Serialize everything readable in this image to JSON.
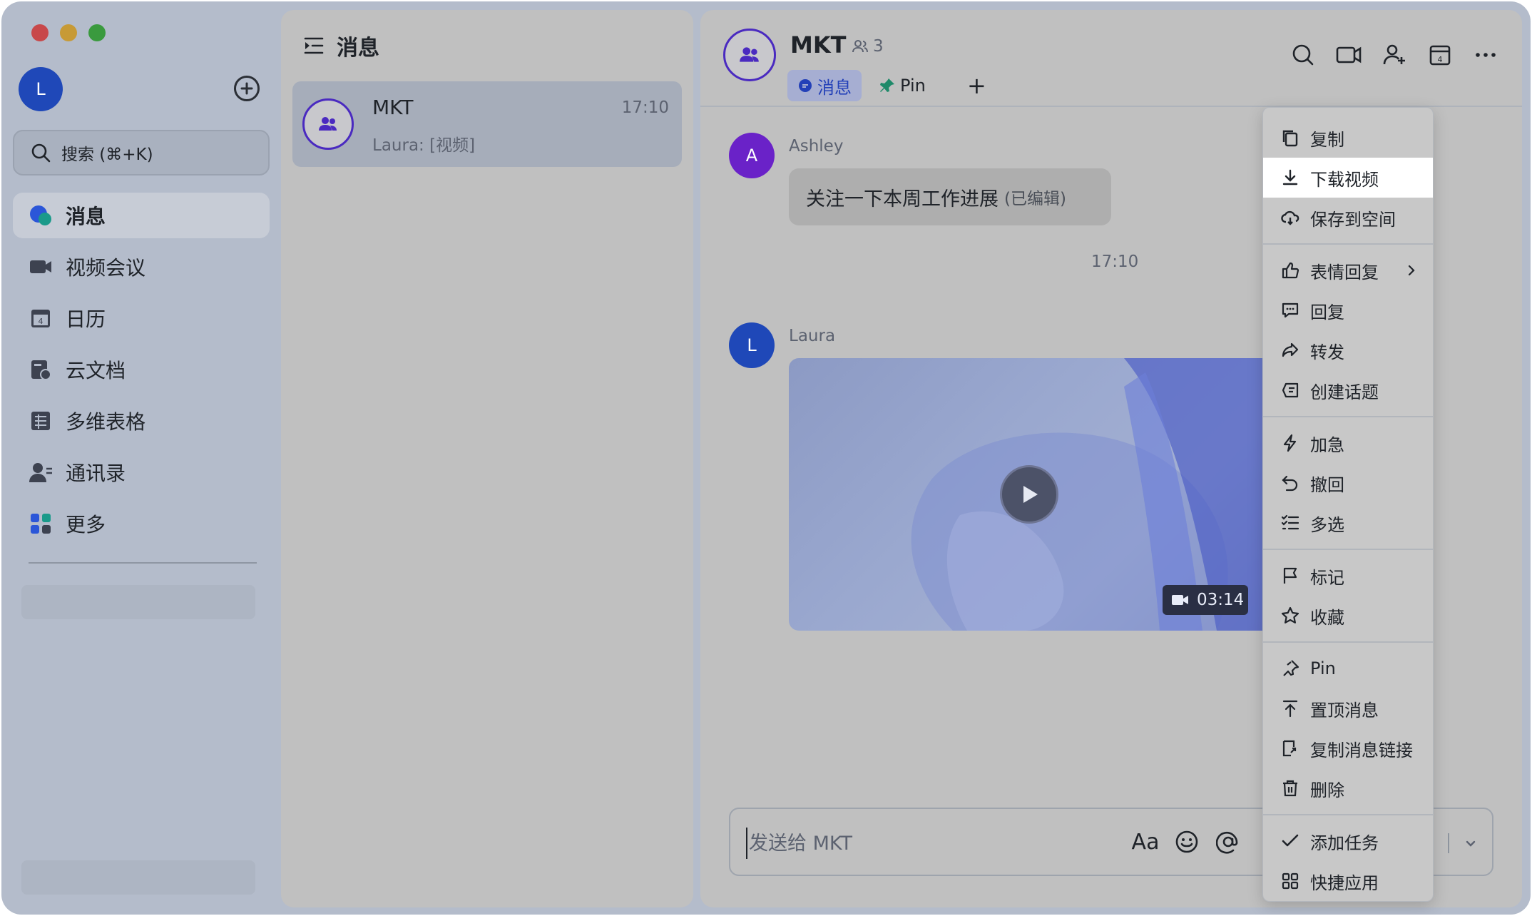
{
  "user": {
    "avatar_initial": "L"
  },
  "search": {
    "placeholder": "搜索 (⌘+K)"
  },
  "sidebar": {
    "items": [
      {
        "label": "消息",
        "icon": "message-bubble-icon",
        "active": true
      },
      {
        "label": "视频会议",
        "icon": "video-camera-icon"
      },
      {
        "label": "日历",
        "icon": "calendar-icon"
      },
      {
        "label": "云文档",
        "icon": "cloud-doc-icon"
      },
      {
        "label": "多维表格",
        "icon": "base-table-icon"
      },
      {
        "label": "通讯录",
        "icon": "contacts-icon"
      },
      {
        "label": "更多",
        "icon": "more-apps-icon"
      }
    ],
    "calendar_day": "4"
  },
  "chat_list": {
    "title": "消息",
    "items": [
      {
        "name": "MKT",
        "time": "17:10",
        "preview": "Laura: [视频]"
      }
    ]
  },
  "conversation": {
    "title": "MKT",
    "member_count": "3",
    "tabs": [
      {
        "label": "消息"
      },
      {
        "label": "Pin"
      }
    ],
    "add_tab": "+",
    "header_calendar_day": "4",
    "messages": [
      {
        "sender": "Ashley",
        "avatar_initial": "A",
        "text": "关注一下本周工作进展",
        "edited_label": "(已编辑)"
      },
      {
        "sender": "Laura",
        "avatar_initial": "L",
        "type": "video",
        "duration": "03:14"
      }
    ],
    "time_separator": "17:10",
    "composer": {
      "placeholder": "发送给 MKT",
      "font_label": "Aa"
    }
  },
  "context_menu": {
    "groups": [
      [
        {
          "label": "复制",
          "icon": "copy-icon"
        },
        {
          "label": "下载视频",
          "icon": "download-icon",
          "highlighted": true
        },
        {
          "label": "保存到空间",
          "icon": "cloud-save-icon"
        }
      ],
      [
        {
          "label": "表情回复",
          "icon": "thumbs-up-icon",
          "submenu": true
        },
        {
          "label": "回复",
          "icon": "reply-icon"
        },
        {
          "label": "转发",
          "icon": "forward-icon"
        },
        {
          "label": "创建话题",
          "icon": "topic-icon"
        }
      ],
      [
        {
          "label": "加急",
          "icon": "lightning-icon"
        },
        {
          "label": "撤回",
          "icon": "undo-icon"
        },
        {
          "label": "多选",
          "icon": "multi-select-icon"
        }
      ],
      [
        {
          "label": "标记",
          "icon": "flag-icon"
        },
        {
          "label": "收藏",
          "icon": "star-icon"
        }
      ],
      [
        {
          "label": "Pin",
          "icon": "pin-icon"
        },
        {
          "label": "置顶消息",
          "icon": "pin-top-icon"
        },
        {
          "label": "复制消息链接",
          "icon": "link-icon"
        },
        {
          "label": "删除",
          "icon": "trash-icon"
        }
      ],
      [
        {
          "label": "添加任务",
          "icon": "task-check-icon"
        },
        {
          "label": "快捷应用",
          "icon": "apps-grid-icon"
        }
      ]
    ]
  },
  "colors": {
    "accent": "#2340b8",
    "group_avatar_border": "#4a2ac0",
    "ashley_avatar": "#6a22c8",
    "laura_avatar": "#1f48b8",
    "pin_icon": "#1f8a6a"
  }
}
